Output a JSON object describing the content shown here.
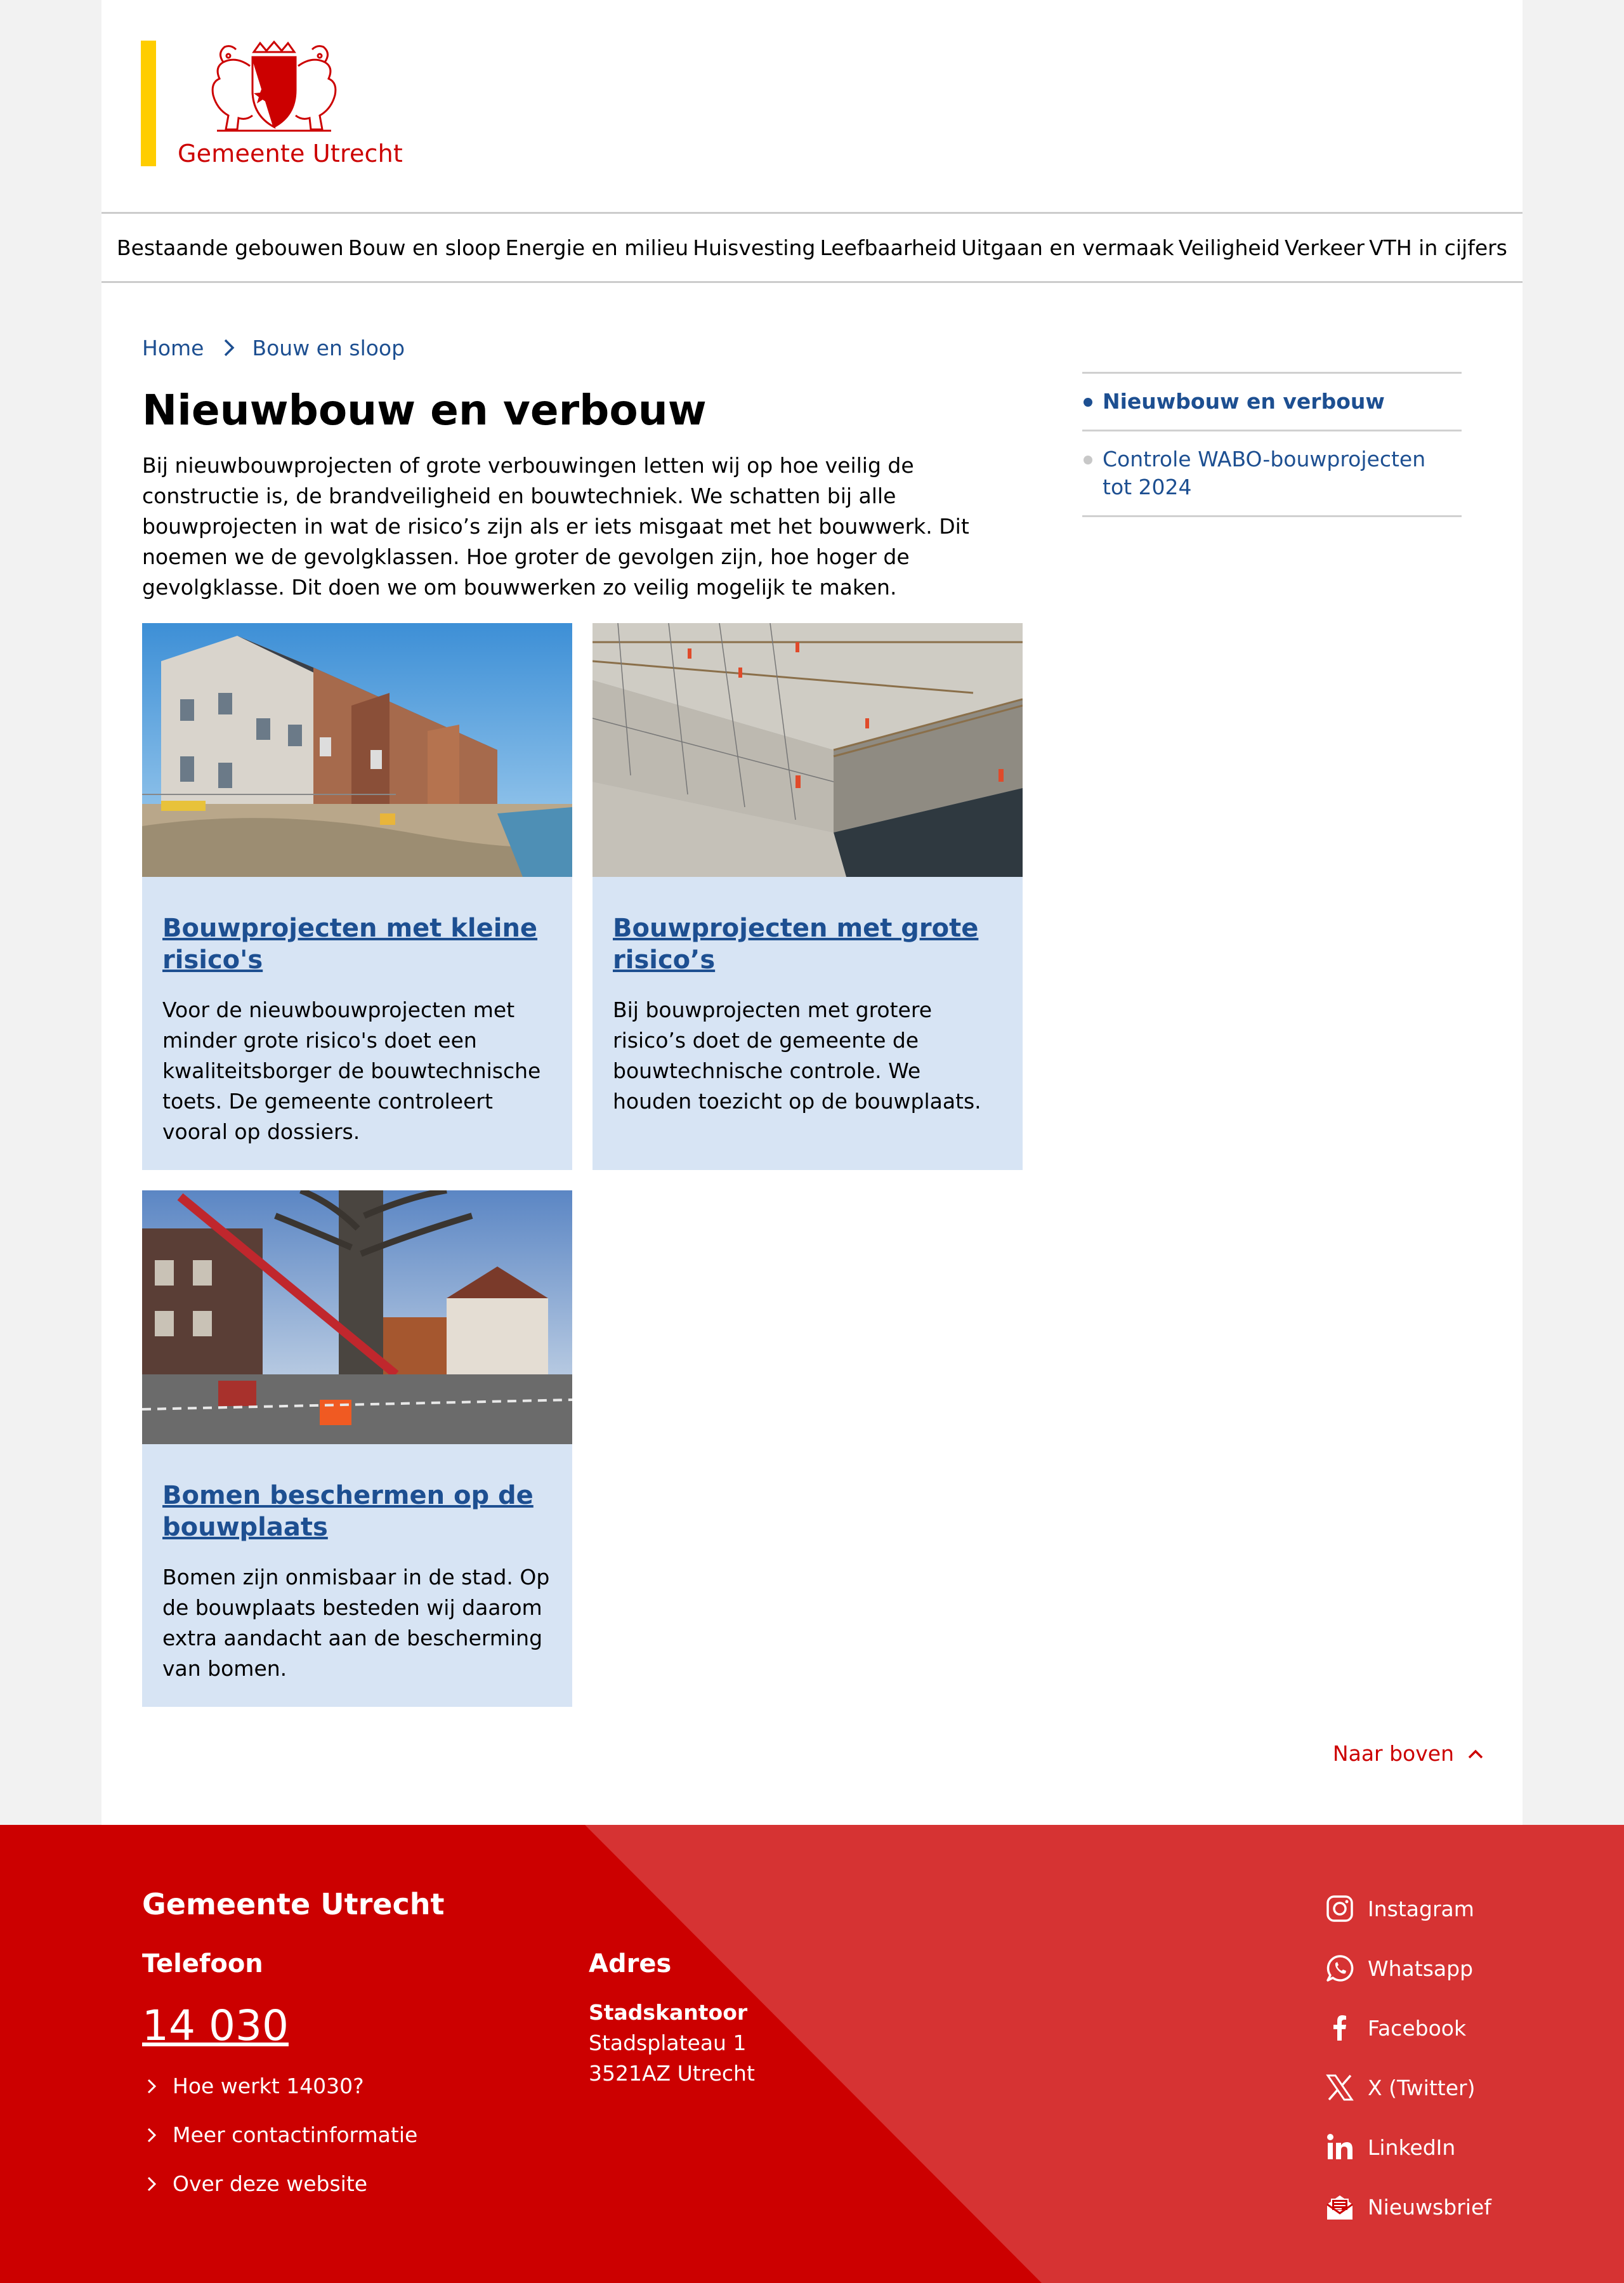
{
  "header": {
    "logo_text": "Gemeente Utrecht"
  },
  "nav": {
    "items": [
      {
        "label": "Bestaande gebouwen"
      },
      {
        "label": "Bouw en sloop"
      },
      {
        "label": "Energie en milieu"
      },
      {
        "label": "Huisvesting"
      },
      {
        "label": "Leefbaarheid"
      },
      {
        "label": "Uitgaan en vermaak"
      },
      {
        "label": "Veiligheid"
      },
      {
        "label": "Verkeer"
      },
      {
        "label": "VTH in cijfers"
      }
    ]
  },
  "breadcrumb": {
    "home": "Home",
    "current": "Bouw en sloop"
  },
  "main": {
    "title": "Nieuwbouw en verbouw",
    "intro": "Bij nieuwbouwprojecten of grote verbouwingen letten wij op hoe veilig de constructie is, de brandveiligheid en bouwtechniek. We schatten bij alle bouwprojecten in wat de risico’s zijn als er iets misgaat met het bouwwerk. Dit noemen we de gevolgklassen. Hoe groter de gevolgen zijn, hoe hoger de gevolgklasse. Dit doen we om bouwwerken zo veilig mogelijk te maken.",
    "cards": [
      {
        "title": "Bouwprojecten met kleine risico's",
        "text": "Voor de nieuwbouwprojecten met minder grote risico's doet een kwaliteitsborger de bouwtechnische toets. De gemeente controleert vooral op dossiers."
      },
      {
        "title": "Bouwprojecten met grote risico’s",
        "text": "Bij bouwprojecten met grotere risico’s doet de gemeente de bouwtechnische controle. We houden toezicht op de bouwplaats."
      },
      {
        "title": "Bomen beschermen op de bouwplaats",
        "text": "Bomen zijn onmisbaar in de stad. Op de bouwplaats besteden wij daarom extra aandacht aan de bescherming van bomen."
      }
    ]
  },
  "sidebar": {
    "items": [
      {
        "label": "Nieuwbouw en verbouw"
      },
      {
        "label": "Controle WABO-bouwprojecten tot 2024"
      }
    ]
  },
  "to_top": "Naar boven",
  "footer": {
    "org": "Gemeente Utrecht",
    "phone_heading": "Telefoon",
    "phone": "14 030",
    "links": [
      {
        "label": "Hoe werkt 14030?"
      },
      {
        "label": "Meer contactinformatie"
      },
      {
        "label": "Over deze website"
      }
    ],
    "address_heading": "Adres",
    "address": {
      "name": "Stadskantoor",
      "street": "Stadsplateau 1",
      "city": "3521AZ Utrecht"
    },
    "social": [
      {
        "label": "Instagram",
        "icon": "instagram-icon"
      },
      {
        "label": "Whatsapp",
        "icon": "whatsapp-icon"
      },
      {
        "label": "Facebook",
        "icon": "facebook-icon"
      },
      {
        "label": "X (Twitter)",
        "icon": "x-twitter-icon"
      },
      {
        "label": "LinkedIn",
        "icon": "linkedin-icon"
      },
      {
        "label": "Nieuwsbrief",
        "icon": "newsletter-icon"
      }
    ]
  },
  "colors": {
    "brand_red": "#cc0000",
    "brand_yellow": "#ffcd00",
    "link_blue": "#1d4f91",
    "card_bg": "#d7e4f4"
  }
}
